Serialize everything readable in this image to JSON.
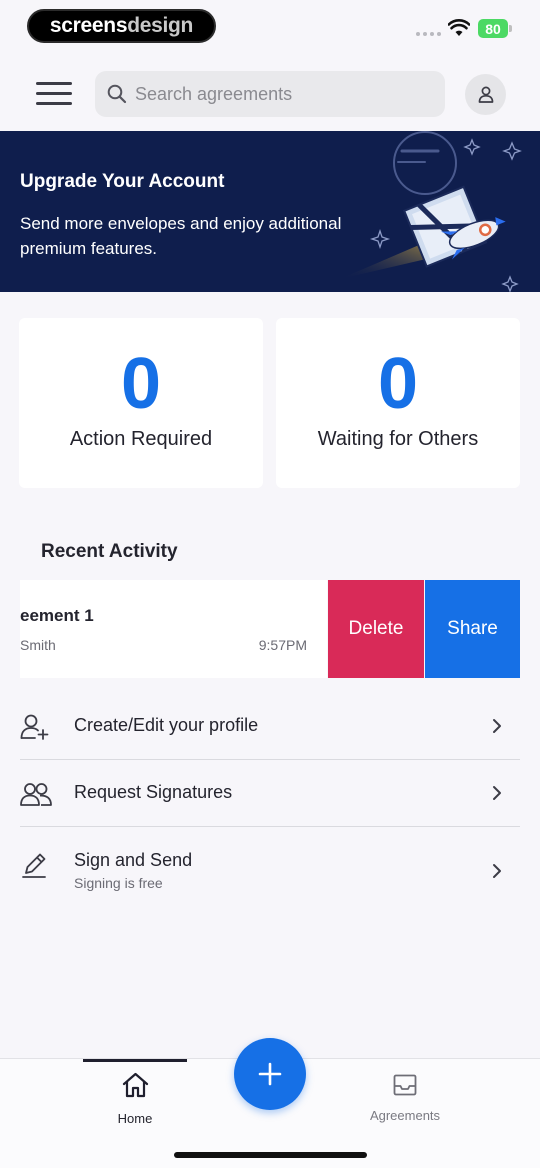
{
  "status_bar": {
    "brand_part1": "screens",
    "brand_part2": "design",
    "battery": "80"
  },
  "header": {
    "search_placeholder": "Search agreements"
  },
  "banner": {
    "title": "Upgrade Your Account",
    "text": "Send more envelopes and enjoy additional premium features."
  },
  "stats": [
    {
      "count": "0",
      "label": "Action Required"
    },
    {
      "count": "0",
      "label": "Waiting for Others"
    }
  ],
  "recent_activity": {
    "title": "Recent Activity",
    "item": {
      "title": "eement 1",
      "subtitle": "Smith",
      "time": "9:57PM"
    },
    "delete_label": "Delete",
    "share_label": "Share"
  },
  "actions": [
    {
      "label": "Create/Edit your profile",
      "icon": "add-person-icon"
    },
    {
      "label": "Request Signatures",
      "icon": "people-icon"
    },
    {
      "label": "Sign and Send",
      "sub": "Signing is free",
      "icon": "pen-icon"
    }
  ],
  "bottom_nav": {
    "home_label": "Home",
    "agreements_label": "Agreements"
  },
  "colors": {
    "accent": "#1670e6",
    "delete": "#d92a58",
    "banner_bg": "#0f1e4d"
  }
}
